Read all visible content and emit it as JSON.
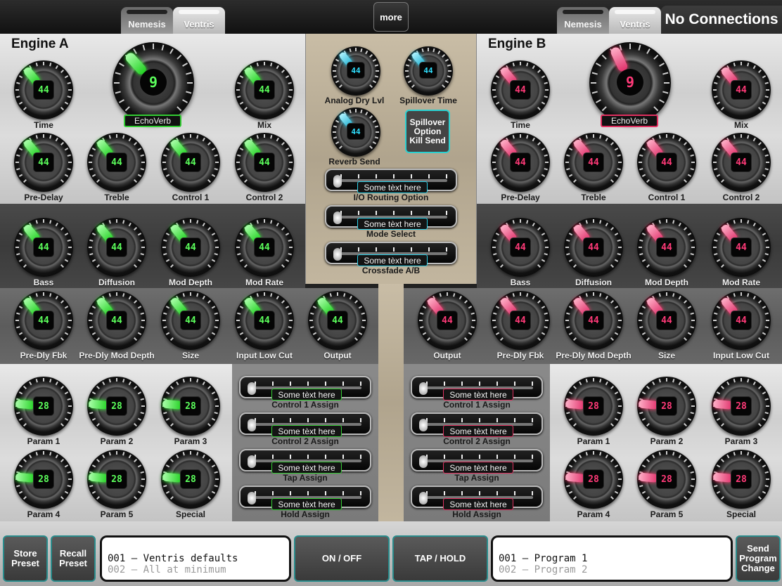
{
  "header": {
    "engine_a_tabs": [
      "Nemesis",
      "Ventris"
    ],
    "engine_b_tabs": [
      "Nemesis",
      "Ventris"
    ],
    "more_label": "more",
    "connection_status": "No Connections"
  },
  "engine_a": {
    "title": "Engine A",
    "algorithm_number": "9",
    "algorithm_name": "EchoVerb",
    "knobs": {
      "time": {
        "label": "Time",
        "value": "44"
      },
      "mix": {
        "label": "Mix",
        "value": "44"
      },
      "pre_delay": {
        "label": "Pre-Delay",
        "value": "44"
      },
      "treble": {
        "label": "Treble",
        "value": "44"
      },
      "control_1": {
        "label": "Control 1",
        "value": "44"
      },
      "control_2": {
        "label": "Control 2",
        "value": "44"
      },
      "bass": {
        "label": "Bass",
        "value": "44"
      },
      "diffusion": {
        "label": "Diffusion",
        "value": "44"
      },
      "mod_depth": {
        "label": "Mod Depth",
        "value": "44"
      },
      "mod_rate": {
        "label": "Mod Rate",
        "value": "44"
      },
      "pre_dly_fbk": {
        "label": "Pre-Dly Fbk",
        "value": "44"
      },
      "pre_dly_mod_depth": {
        "label": "Pre-Dly Mod Depth",
        "value": "44"
      },
      "size": {
        "label": "Size",
        "value": "44"
      },
      "input_low_cut": {
        "label": "Input Low Cut",
        "value": "44"
      },
      "output": {
        "label": "Output",
        "value": "44"
      },
      "param_1": {
        "label": "Param 1",
        "value": "28"
      },
      "param_2": {
        "label": "Param 2",
        "value": "28"
      },
      "param_3": {
        "label": "Param 3",
        "value": "28"
      },
      "param_4": {
        "label": "Param 4",
        "value": "28"
      },
      "param_5": {
        "label": "Param 5",
        "value": "28"
      },
      "special": {
        "label": "Special",
        "value": "28"
      }
    },
    "assigns": [
      {
        "label": "Control 1 Assign",
        "value": "Some tèxt here"
      },
      {
        "label": "Control 2 Assign",
        "value": "Some tèxt here"
      },
      {
        "label": "Tap Assign",
        "value": "Some tèxt here"
      },
      {
        "label": "Hold Assign",
        "value": "Some tèxt here"
      }
    ]
  },
  "engine_b": {
    "title": "Engine B",
    "algorithm_number": "9",
    "algorithm_name": "EchoVerb",
    "knobs": {
      "time": {
        "label": "Time",
        "value": "44"
      },
      "mix": {
        "label": "Mix",
        "value": "44"
      },
      "pre_delay": {
        "label": "Pre-Delay",
        "value": "44"
      },
      "treble": {
        "label": "Treble",
        "value": "44"
      },
      "control_1": {
        "label": "Control 1",
        "value": "44"
      },
      "control_2": {
        "label": "Control 2",
        "value": "44"
      },
      "bass": {
        "label": "Bass",
        "value": "44"
      },
      "diffusion": {
        "label": "Diffusion",
        "value": "44"
      },
      "mod_depth": {
        "label": "Mod Depth",
        "value": "44"
      },
      "mod_rate": {
        "label": "Mod Rate",
        "value": "44"
      },
      "output": {
        "label": "Output",
        "value": "44"
      },
      "pre_dly_fbk": {
        "label": "Pre-Dly Fbk",
        "value": "44"
      },
      "pre_dly_mod_depth": {
        "label": "Pre-Dly Mod Depth",
        "value": "44"
      },
      "size": {
        "label": "Size",
        "value": "44"
      },
      "input_low_cut": {
        "label": "Input Low Cut",
        "value": "44"
      },
      "param_1": {
        "label": "Param 1",
        "value": "28"
      },
      "param_2": {
        "label": "Param 2",
        "value": "28"
      },
      "param_3": {
        "label": "Param 3",
        "value": "28"
      },
      "param_4": {
        "label": "Param 4",
        "value": "28"
      },
      "param_5": {
        "label": "Param 5",
        "value": "28"
      },
      "special": {
        "label": "Special",
        "value": "28"
      }
    },
    "assigns": [
      {
        "label": "Control 1 Assign",
        "value": "Some tèxt here"
      },
      {
        "label": "Control 2 Assign",
        "value": "Some tèxt here"
      },
      {
        "label": "Tap Assign",
        "value": "Some tèxt here"
      },
      {
        "label": "Hold Assign",
        "value": "Some tèxt here"
      }
    ]
  },
  "center": {
    "analog_dry_lvl": {
      "label": "Analog Dry Lvl",
      "value": "44"
    },
    "spillover_time": {
      "label": "Spillover Time",
      "value": "44"
    },
    "reverb_send": {
      "label": "Reverb Send",
      "value": "44"
    },
    "spillover_kill": "Spillover Option Kill Send",
    "sliders": [
      {
        "label": "I/O Routing Option",
        "value": "Some tèxt here"
      },
      {
        "label": "Mode Select",
        "value": "Some tèxt here"
      },
      {
        "label": "Crossfade A/B",
        "value": "Some tèxt here"
      }
    ]
  },
  "footer": {
    "store_preset": "Store Preset",
    "recall_preset": "Recall Preset",
    "presets": [
      "001 – Ventris defaults",
      "002 – All at minimum"
    ],
    "on_off": "ON / OFF",
    "tap_hold": "TAP / HOLD",
    "programs": [
      "001 – Program 1",
      "002 – Program 2"
    ],
    "send_program_change": "Send Program Change"
  },
  "colors": {
    "engine_a_accent": "#33ee33",
    "engine_b_accent": "#ee3070",
    "center_accent": "#30d8f0",
    "button_border": "#2a8c8c"
  }
}
